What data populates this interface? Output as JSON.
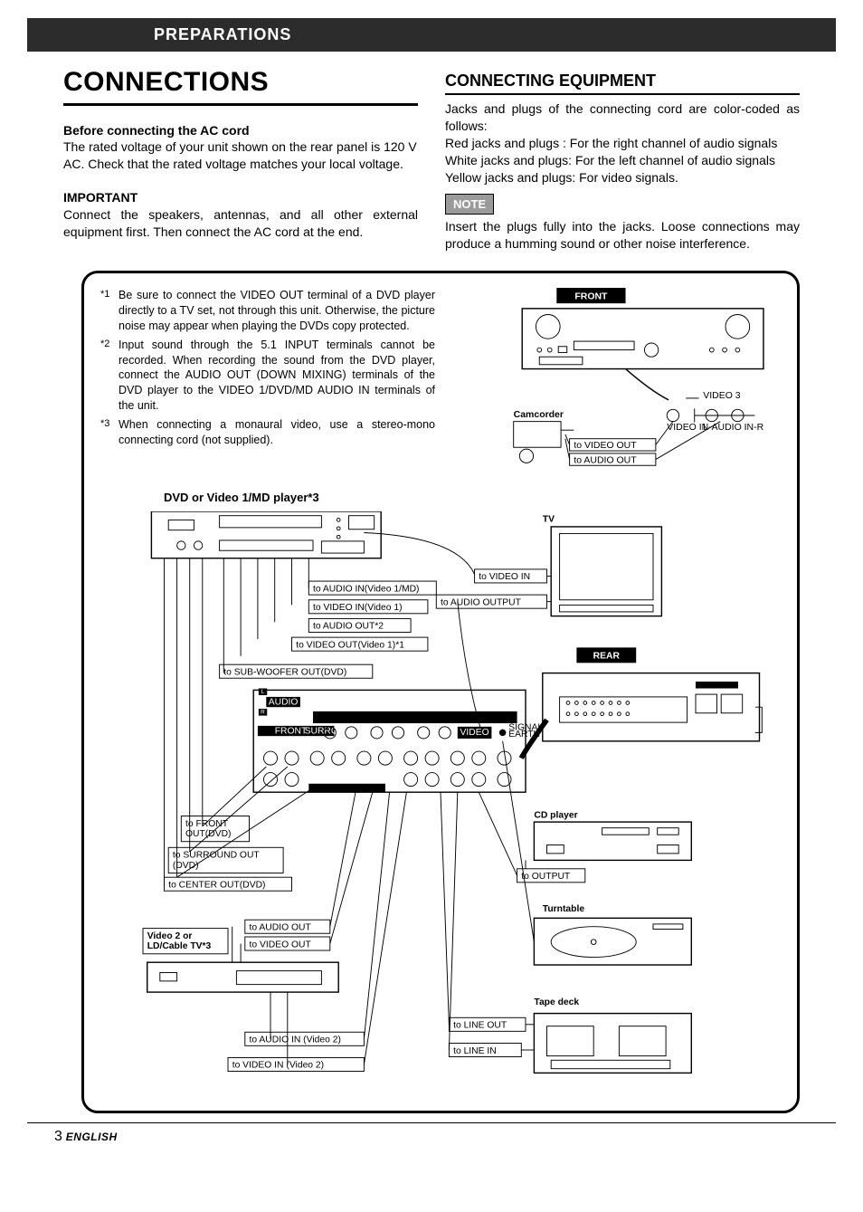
{
  "header_band": "PREPARATIONS",
  "left": {
    "title": "CONNECTIONS",
    "before_h": "Before connecting the AC cord",
    "before_p": "The rated voltage of your unit shown on the rear panel is 120 V AC. Check that the rated voltage matches your local voltage.",
    "imp_h": "IMPORTANT",
    "imp_p": "Connect the speakers, antennas, and all other external equipment first. Then connect the AC cord at the end."
  },
  "right": {
    "title": "CONNECTING EQUIPMENT",
    "intro": "Jacks and plugs of the connecting cord are color-coded as follows:",
    "line_red": "Red jacks and plugs : For the right channel of audio signals",
    "line_white": "White jacks and plugs: For the left channel of audio signals",
    "line_yellow": "Yellow jacks and plugs: For video signals.",
    "note_label": "NOTE",
    "note_p": "Insert the plugs fully into the jacks. Loose connections may produce a humming sound or other noise interference."
  },
  "footnotes": {
    "f1m": "*1",
    "f1": "Be sure to connect the VIDEO OUT terminal of a DVD player directly to a TV set, not through this unit. Otherwise, the picture noise may appear when playing the DVDs copy protected.",
    "f2m": "*2",
    "f2": "Input sound through the 5.1 INPUT terminals cannot be recorded. When recording the sound from the DVD player, connect the AUDIO OUT (DOWN MIXING) terminals of the DVD player to the VIDEO 1/DVD/MD AUDIO IN terminals of the unit.",
    "f3m": "*3",
    "f3": "When connecting a monaural video, use a stereo-mono connecting cord (not supplied)."
  },
  "diagram": {
    "dvd_heading": "DVD or Video 1/MD player*3",
    "front_label": "FRONT",
    "rear_label": "REAR",
    "camcorder": "Camcorder",
    "video3": "VIDEO 3",
    "video_in_l": "VIDEO IN",
    "audio_in_r": "L-AUDIO IN-R",
    "to_video_out": "to VIDEO OUT",
    "to_audio_out": "to AUDIO OUT",
    "tv": "TV",
    "to_video_in_tv": "to VIDEO IN",
    "to_audio_output_tv": "to AUDIO OUTPUT",
    "to_audio_in_v1md": "to AUDIO IN(Video 1/MD)",
    "to_video_in_v1": "to VIDEO IN(Video 1)",
    "to_audio_out_star2": "to AUDIO OUT*2",
    "to_video_out_v1_star1": "to VIDEO OUT(Video 1)*1",
    "to_sub_out_dvd": "to SUB-WOOFER OUT(DVD)",
    "to_front_out_dvd": "to FRONT\nOUT(DVD)",
    "to_surround_out_dvd": "to SURROUND OUT\n(DVD)",
    "to_center_out_dvd": "to CENTER OUT(DVD)",
    "to_audio_out2": "to AUDIO OUT",
    "to_video_out2": "to VIDEO OUT",
    "video2_ld": "Video 2 or\nLD/Cable TV*3",
    "to_audio_in_v2": "to AUDIO IN (Video 2)",
    "to_video_in_v2": "to VIDEO IN (Video 2)",
    "cd_player": "CD player",
    "to_output": "to OUTPUT",
    "turntable": "Turntable",
    "tape_deck": "Tape deck",
    "to_line_out": "to LINE OUT",
    "to_line_in": "to LINE IN",
    "panel_video": "VIDEO",
    "panel_audio": "AUDIO",
    "panel_signal_earth": "SIGNAL\nEARTH",
    "panel_front": "FRONT",
    "panel_surround": "SURROUND"
  },
  "footer": {
    "page": "3",
    "lang": "ENGLISH"
  }
}
